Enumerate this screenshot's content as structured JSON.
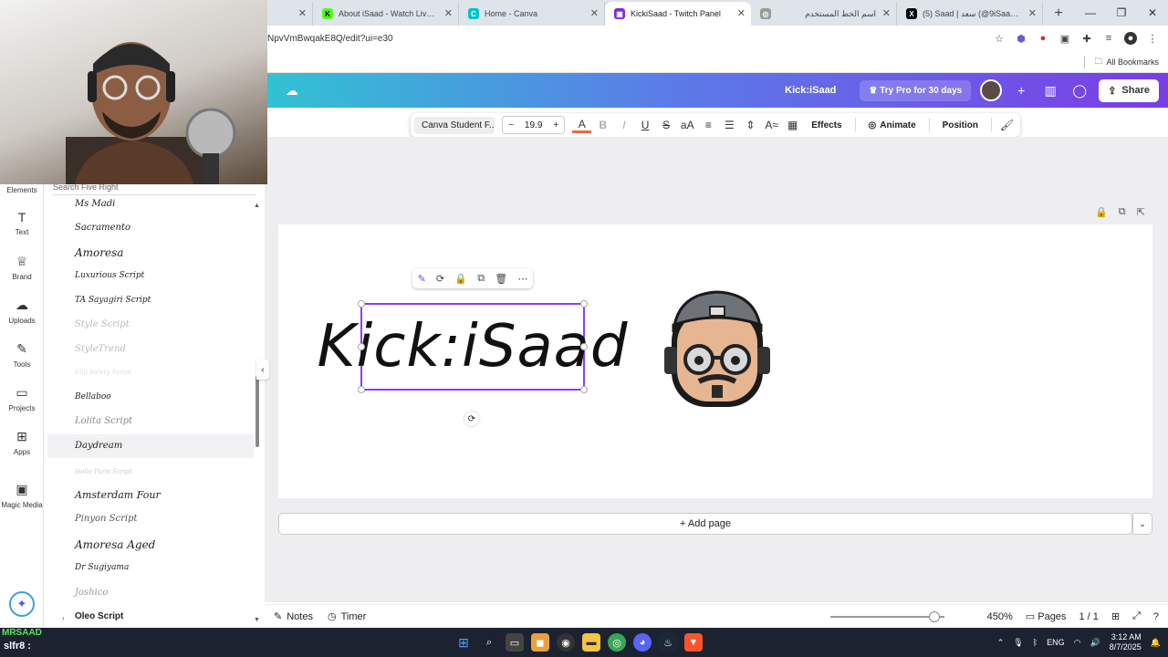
{
  "browser": {
    "tabs": [
      {
        "title": "",
        "color": "#777"
      },
      {
        "title": "About iSaad - Watch Live on Ki",
        "color": "#53fc18"
      },
      {
        "title": "Home - Canva",
        "color": "#00c4cc"
      },
      {
        "title": "KickiSaad - Twitch Panel",
        "color": "#7d2ae8"
      },
      {
        "title": "اسم الخط المستخدم",
        "color": "#999"
      },
      {
        "title": "(5) Saad | سعد (@9iSaad) / X",
        "color": "#000000"
      }
    ],
    "url": "NpvVmBwqakE8Q/edit?ui=e30",
    "all_bookmarks": "All Bookmarks"
  },
  "canva_header": {
    "doc_title": "Kick:iSaad",
    "try_pro": "Try Pro for 30 days",
    "share": "Share"
  },
  "toolbar": {
    "font_name": "Canva Student F...",
    "minus": "−",
    "font_size": "19.9",
    "plus": "+",
    "effects": "Effects",
    "animate": "Animate",
    "position": "Position"
  },
  "rail": [
    {
      "label": "Elements"
    },
    {
      "label": "Text"
    },
    {
      "label": "Brand"
    },
    {
      "label": "Uploads"
    },
    {
      "label": "Tools"
    },
    {
      "label": "Projects"
    },
    {
      "label": "Apps"
    },
    {
      "label": "Magic Media"
    }
  ],
  "font_panel": {
    "search_text": "Search Five Right",
    "fonts": [
      {
        "name": "Ms Madi"
      },
      {
        "name": "Sacramento"
      },
      {
        "name": "Amoresa"
      },
      {
        "name": "Luxurious Script"
      },
      {
        "name": "TA Sayagiri Script"
      },
      {
        "name": "Style Script"
      },
      {
        "name": "StyleTrend"
      },
      {
        "name": "Ella Safety Script"
      },
      {
        "name": "Bellaboo"
      },
      {
        "name": "Lolita Script"
      },
      {
        "name": "Daydream"
      },
      {
        "name": "Hello Paris Script"
      },
      {
        "name": "Amsterdam Four"
      },
      {
        "name": "Pinyon Script"
      },
      {
        "name": "Amoresa Aged"
      },
      {
        "name": "Dr Sugiyama"
      },
      {
        "name": "Joshico"
      },
      {
        "name": "Oleo Script"
      }
    ]
  },
  "canvas": {
    "text": "Kick:iSaad",
    "add_page": "+ Add page"
  },
  "bottombar": {
    "notes": "Notes",
    "timer": "Timer",
    "zoom": "450%",
    "zoom_level": 0.91,
    "pages": "Pages",
    "page_count": "1 / 1"
  },
  "taskbar": {
    "stream_line1": "MRSAAD",
    "stream_line2": "slfr8 :",
    "lang": "ENG",
    "time": "3:12 AM",
    "date": "8/7/2025"
  },
  "colors": {
    "accent": "#8b3dff",
    "header_start": "#31c2d3",
    "header_end": "#7a3de6"
  }
}
